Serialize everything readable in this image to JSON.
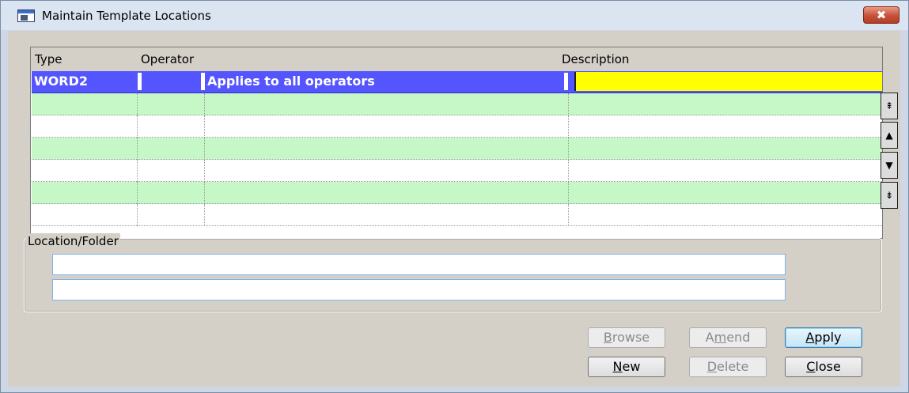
{
  "window": {
    "title": "Maintain Template Locations",
    "close_label": "✖"
  },
  "grid": {
    "columns": [
      "Type",
      "Operator",
      "Description"
    ],
    "selected_row": {
      "type": "WORD2",
      "operator": "",
      "description": "Applies to all operators",
      "location": ""
    }
  },
  "scroll": {
    "first": "⇞",
    "up": "▲",
    "down": "▼",
    "last": "⇟"
  },
  "group": {
    "label": "Location/Folder",
    "field1": "",
    "field2": ""
  },
  "buttons": {
    "browse": {
      "b": "",
      "u": "B",
      "a": "rowse"
    },
    "amend": {
      "b": "A",
      "u": "m",
      "a": "end"
    },
    "apply": {
      "b": "",
      "u": "A",
      "a": "pply"
    },
    "new": {
      "b": "",
      "u": "N",
      "a": "ew"
    },
    "delete": {
      "b": "",
      "u": "D",
      "a": "elete"
    },
    "close": {
      "b": "",
      "u": "C",
      "a": "lose"
    }
  }
}
